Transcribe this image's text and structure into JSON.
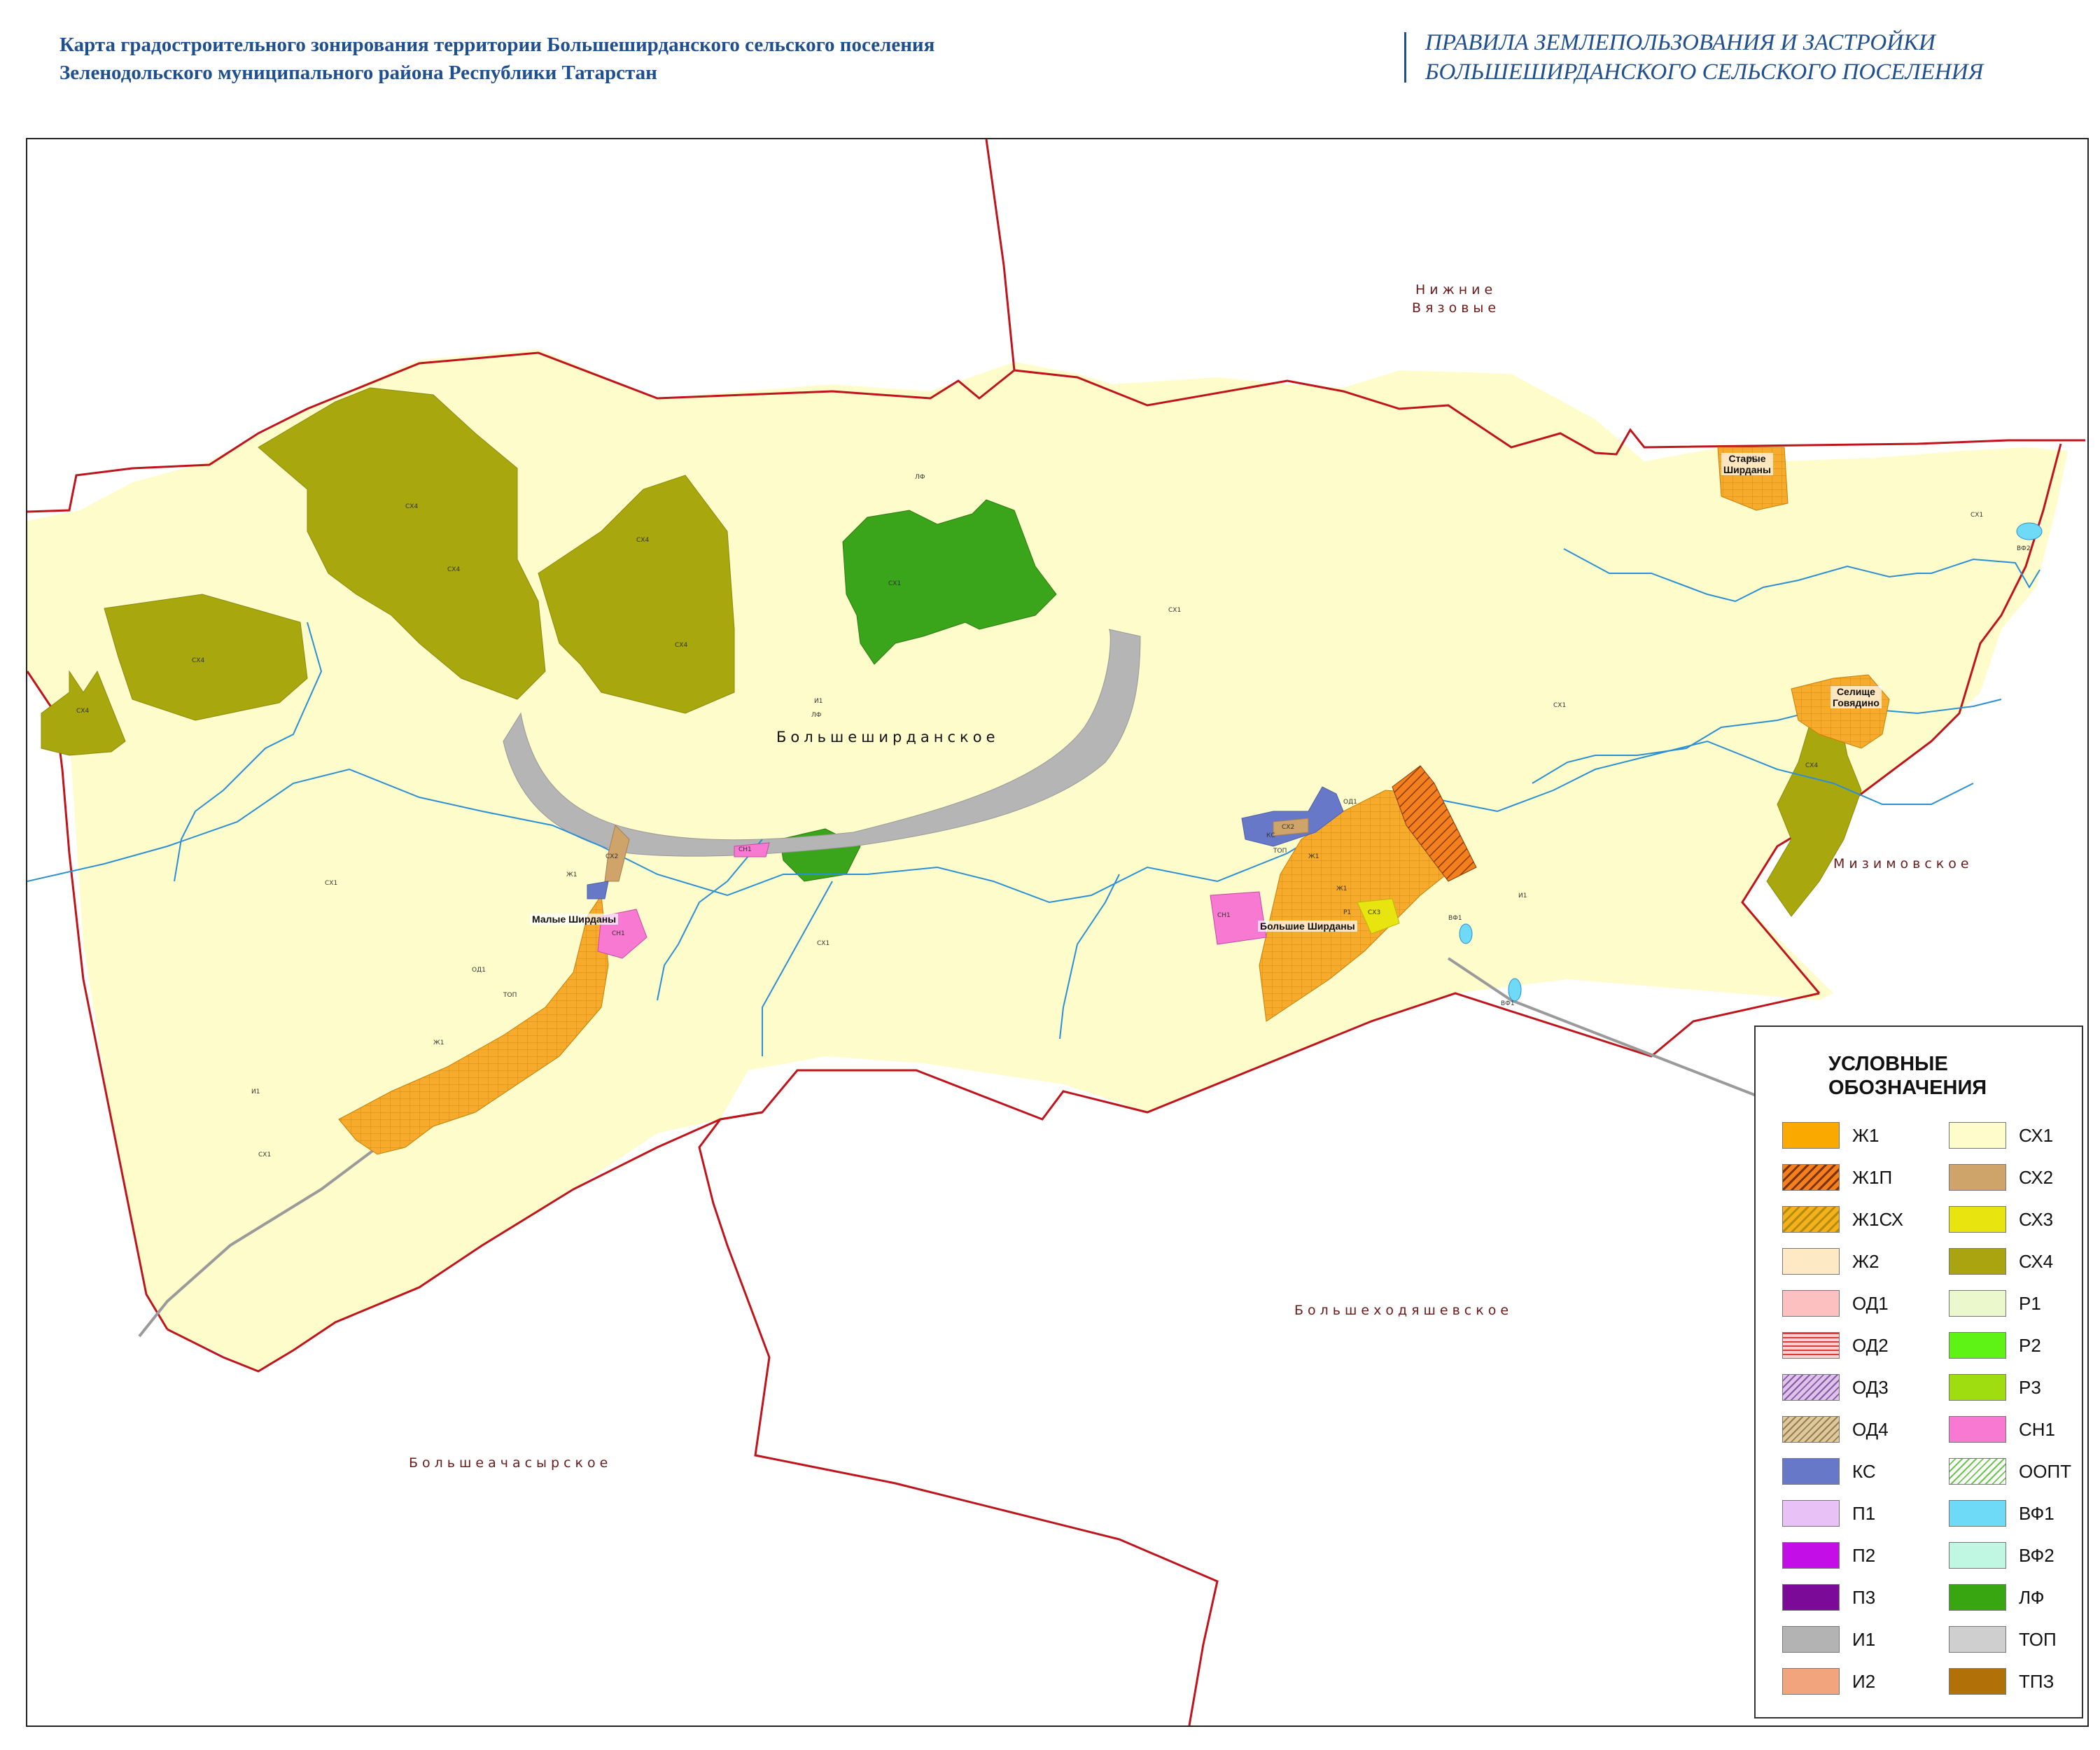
{
  "header": {
    "title_line1": "Карта градостроительного зонирования территории Большеширданского сельского поселения",
    "title_line2": "Зеленодольского муниципального района Республики Татарстан",
    "rules_line1": "ПРАВИЛА ЗЕМЛЕПОЛЬЗОВАНИЯ И ЗАСТРОЙКИ",
    "rules_line2": "БОЛЬШЕШИРДАНСКОГО СЕЛЬСКОГО ПОСЕЛЕНИЯ"
  },
  "map": {
    "neighbors": {
      "north_line1": "Нижние",
      "north_line2": "Вязовые",
      "east": "Мизимовское",
      "south": "Большеходяшевское",
      "southwest": "Большеачасырское"
    },
    "municipality": "Большеширданское",
    "settlements": {
      "malye_shirdany": "Малые Ширданы",
      "bolshie_shirdany": "Большие Ширданы",
      "starye_line1": "Старые",
      "starye_line2": "Ширданы",
      "govyadino_line1": "Селище",
      "govyadino_line2": "Говядино"
    },
    "zone_tags": {
      "sx1": "СХ1",
      "sx2": "СХ2",
      "sx3": "СХ3",
      "sx4": "СХ4",
      "lf": "ЛФ",
      "i1": "И1",
      "zh1": "Ж1",
      "od1": "ОД1",
      "top": "ТОП",
      "ks": "КС",
      "sn1": "СН1",
      "r1": "Р1",
      "vf1": "ВФ1",
      "vf2": "ВФ2"
    },
    "colors": {
      "boundary": "#c0141c",
      "sx1": "#fffccc",
      "sx4": "#a8a80e",
      "road": "#b5b5b5",
      "water": "#2a8fd4",
      "zh1": "#f6ab2c",
      "lf": "#3aa51b"
    }
  },
  "legend": {
    "title_line1": "УСЛОВНЫЕ",
    "title_line2": "ОБОЗНАЧЕНИЯ",
    "left": [
      {
        "code": "Ж1",
        "color": "#f9a900",
        "pattern": "solid"
      },
      {
        "code": "Ж1П",
        "color": "#f37f1e",
        "pattern": "hatch-dark"
      },
      {
        "code": "Ж1СХ",
        "color": "#f3b21b",
        "pattern": "hatch-olive"
      },
      {
        "code": "Ж2",
        "color": "#fde9c3",
        "pattern": "solid"
      },
      {
        "code": "ОД1",
        "color": "#fcc0c0",
        "pattern": "solid"
      },
      {
        "code": "ОД2",
        "color": "#fbd0d0",
        "pattern": "stripe-red"
      },
      {
        "code": "ОД3",
        "color": "#dcc3e8",
        "pattern": "hatch-purple"
      },
      {
        "code": "ОД4",
        "color": "#dcc9a0",
        "pattern": "hatch-brown"
      },
      {
        "code": "КС",
        "color": "#6778c8",
        "pattern": "solid"
      },
      {
        "code": "П1",
        "color": "#e8c2f6",
        "pattern": "solid"
      },
      {
        "code": "П2",
        "color": "#c40ee8",
        "pattern": "solid"
      },
      {
        "code": "П3",
        "color": "#7b0a98",
        "pattern": "solid"
      },
      {
        "code": "И1",
        "color": "#b3b3b3",
        "pattern": "solid"
      },
      {
        "code": "И2",
        "color": "#f2a47c",
        "pattern": "solid"
      }
    ],
    "right": [
      {
        "code": "СХ1",
        "color": "#fffccc",
        "pattern": "solid"
      },
      {
        "code": "СХ2",
        "color": "#cfa46b",
        "pattern": "solid"
      },
      {
        "code": "СХ3",
        "color": "#e7e40f",
        "pattern": "solid"
      },
      {
        "code": "СХ4",
        "color": "#a9a410",
        "pattern": "solid"
      },
      {
        "code": "Р1",
        "color": "#ebf8cc",
        "pattern": "solid"
      },
      {
        "code": "Р2",
        "color": "#5ff215",
        "pattern": "solid"
      },
      {
        "code": "Р3",
        "color": "#9fdc10",
        "pattern": "solid"
      },
      {
        "code": "СН1",
        "color": "#f779d2",
        "pattern": "solid"
      },
      {
        "code": "ООПТ",
        "color": "#ffffff",
        "pattern": "hatch-green"
      },
      {
        "code": "ВФ1",
        "color": "#6fdaf8",
        "pattern": "solid"
      },
      {
        "code": "ВФ2",
        "color": "#bff7e3",
        "pattern": "solid"
      },
      {
        "code": "ЛФ",
        "color": "#38a610",
        "pattern": "solid"
      },
      {
        "code": "ТОП",
        "color": "#cfcfcf",
        "pattern": "solid"
      },
      {
        "code": "ТПЗ",
        "color": "#b27008",
        "pattern": "solid"
      }
    ]
  }
}
